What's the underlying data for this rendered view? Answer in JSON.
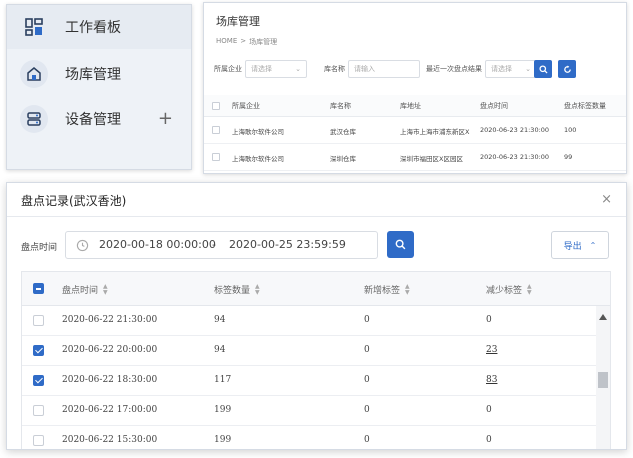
{
  "sidebar": {
    "items": [
      {
        "label": "工作看板",
        "icon": "dashboard-icon"
      },
      {
        "label": "场库管理",
        "icon": "warehouse-icon"
      },
      {
        "label": "设备管理",
        "icon": "server-icon",
        "expand": "+"
      }
    ]
  },
  "site_panel": {
    "title": "场库管理",
    "breadcrumb": [
      "HOME",
      ">",
      "场库管理"
    ],
    "filters": [
      {
        "label": "所属企业",
        "placeholder": "请选择"
      },
      {
        "label": "库名称",
        "placeholder": "请输入"
      },
      {
        "label": "最近一次盘点结果",
        "placeholder": "请选择"
      }
    ],
    "columns": [
      "所属企业",
      "库名称",
      "库地址",
      "盘点时间",
      "盘点标签数量"
    ],
    "rows": [
      [
        "上海歌尔软件公司",
        "武汉仓库",
        "上海市上海市浦东新区X",
        "2020-06-23 21:30:00",
        "100"
      ],
      [
        "上海歌尔软件公司",
        "深圳仓库",
        "深圳市福田区X区园区",
        "2020-06-23 21:30:00",
        "99"
      ]
    ]
  },
  "modal": {
    "title": "盘点记录(武汉香池)",
    "close": "×",
    "filter_label": "盘点时间",
    "range_start": "2020-00-18 00:00:00",
    "range_sep": "-",
    "range_end": "2020-00-25 23:59:59",
    "export_label": "导出",
    "columns": [
      "盘点时间",
      "标签数量",
      "新增标签",
      "减少标签"
    ],
    "rows": [
      {
        "time": "2020-06-22 21:30:00",
        "count": "94",
        "added": "0",
        "reduced": "0",
        "checked": false,
        "link": false
      },
      {
        "time": "2020-06-22 20:00:00",
        "count": "94",
        "added": "0",
        "reduced": "23",
        "checked": true,
        "link": true
      },
      {
        "time": "2020-06-22 18:30:00",
        "count": "117",
        "added": "0",
        "reduced": "83",
        "checked": true,
        "link": true
      },
      {
        "time": "2020-06-22 17:00:00",
        "count": "199",
        "added": "0",
        "reduced": "0",
        "checked": false,
        "link": false
      },
      {
        "time": "2020-06-22 15:30:00",
        "count": "199",
        "added": "0",
        "reduced": "0",
        "checked": false,
        "link": false
      }
    ]
  },
  "colors": {
    "accent": "#2f6bc7",
    "sidebar_bg": "#eef2f7"
  }
}
